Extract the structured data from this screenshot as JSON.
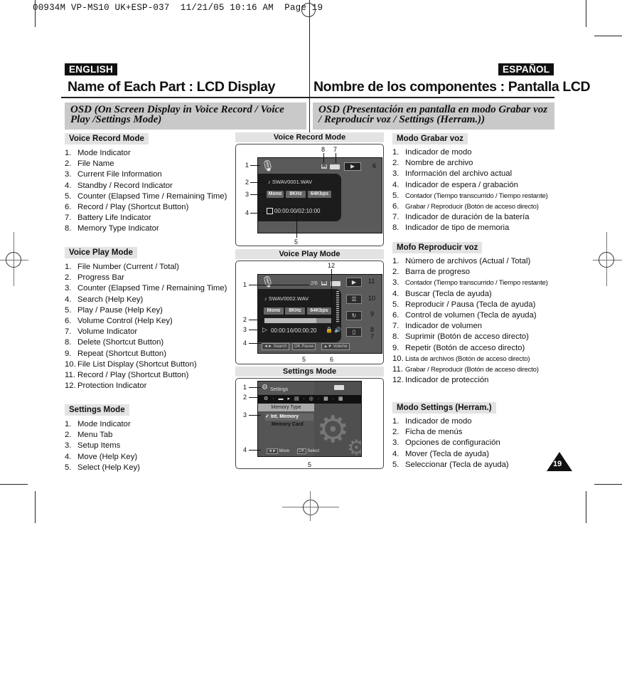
{
  "slug": "00934M VP-MS10 UK+ESP-037  11/21/05 10:16 AM  Page 19",
  "english": {
    "badge": "ENGLISH",
    "title": "Name of Each Part : LCD Display",
    "osd_heading": "OSD (On Screen Display in Voice Record / Voice Play /Settings Mode)",
    "sections": [
      {
        "heading": "Voice Record Mode",
        "items": [
          "Mode Indicator",
          "File Name",
          "Current File Information",
          "Standby / Record Indicator",
          "Counter (Elapsed Time / Remaining Time)",
          "Record / Play (Shortcut Button)",
          "Battery Life Indicator",
          "Memory Type Indicator"
        ]
      },
      {
        "heading": "Voice Play Mode",
        "items": [
          "File Number (Current / Total)",
          "Progress Bar",
          "Counter (Elapsed Time / Remaining Time)",
          "Search (Help Key)",
          "Play / Pause (Help Key)",
          "Volume Control (Help Key)",
          "Volume Indicator",
          "Delete (Shortcut Button)",
          "Repeat (Shortcut Button)",
          "File List Display (Shortcut Button)",
          "Record / Play (Shortcut Button)",
          "Protection Indicator"
        ]
      },
      {
        "heading": "Settings Mode",
        "items": [
          "Mode Indicator",
          "Menu Tab",
          "Setup Items",
          "Move (Help Key)",
          "Select (Help Key)"
        ]
      }
    ]
  },
  "spanish": {
    "badge": "ESPAÑOL",
    "title": "Nombre de los componentes : Pantalla LCD",
    "osd_heading": "OSD (Presentación en pantalla en modo Grabar voz / Reproducir voz / Settings (Herram.))",
    "sections": [
      {
        "heading": "Modo Grabar voz",
        "items": [
          "Indicador de modo",
          "Nombre de archivo",
          "Información del archivo actual",
          "Indicador de espera / grabación",
          "Contador (Tiempo transcurrido / Tiempo restante)",
          "Grabar / Reproducir (Botón de acceso directo)",
          "Indicador de duración de la batería",
          "Indicador de tipo de memoria"
        ]
      },
      {
        "heading": "Mofo Reproducir voz",
        "items": [
          "Número de archivos (Actual / Total)",
          "Barra de progreso",
          "Contador (Tiempo transcurrido / Tiempo restante)",
          "Buscar (Tecla de ayuda)",
          "Reproducir / Pausa (Tecla de ayuda)",
          "Control de volumen (Tecla de ayuda)",
          "Indicador de volumen",
          "Suprimir (Botón de acceso directo)",
          "Repetir (Botón de acceso directo)",
          "Lista de archivos (Botón de acceso directo)",
          "Grabar / Reproducir (Botón de acceso directo)",
          "Indicador de protección"
        ]
      },
      {
        "heading": "Modo Settings (Herram.)",
        "items": [
          "Indicador de modo",
          "Ficha de menús",
          "Opciones de configuración",
          "Mover (Tecla de ayuda)",
          "Seleccionar (Tecla de ayuda)"
        ]
      }
    ]
  },
  "screens": {
    "record": {
      "heading": "Voice Record Mode",
      "file_name": "SWAV0001.WAV",
      "chips": [
        "Mono",
        "8KHz",
        "64Kbps"
      ],
      "counter": "00:00:00/02:10:00",
      "memory_icon": "IN",
      "callouts": [
        "1",
        "2",
        "3",
        "4",
        "5",
        "6",
        "7",
        "8"
      ]
    },
    "play": {
      "heading": "Voice Play Mode",
      "file_number": "2/6",
      "file_name": "SWAV0002.WAV",
      "chips": [
        "Mono",
        "8KHz",
        "64Kbps"
      ],
      "counter": "00:00:16/00:00:20",
      "progress": 0.78,
      "memory_icon": "IN",
      "help_keys": [
        "Search",
        "Pause",
        "Volume"
      ],
      "help_key_prefix": [
        "◄►",
        "OK",
        "▲▼"
      ],
      "callouts": [
        "1",
        "2",
        "3",
        "4",
        "5",
        "6",
        "7",
        "8",
        "9",
        "10",
        "11",
        "12"
      ]
    },
    "settings": {
      "heading": "Settings Mode",
      "mode_label": "Settings",
      "menu_title": "Memory Type",
      "options": [
        "Int. Memory",
        "Memory Card"
      ],
      "selected_option": "Int. Memory",
      "help_keys": [
        "Move",
        "Select"
      ],
      "help_key_prefix": [
        "◄►",
        "OK"
      ],
      "callouts": [
        "1",
        "2",
        "3",
        "4",
        "5"
      ]
    }
  },
  "page_number": "19"
}
